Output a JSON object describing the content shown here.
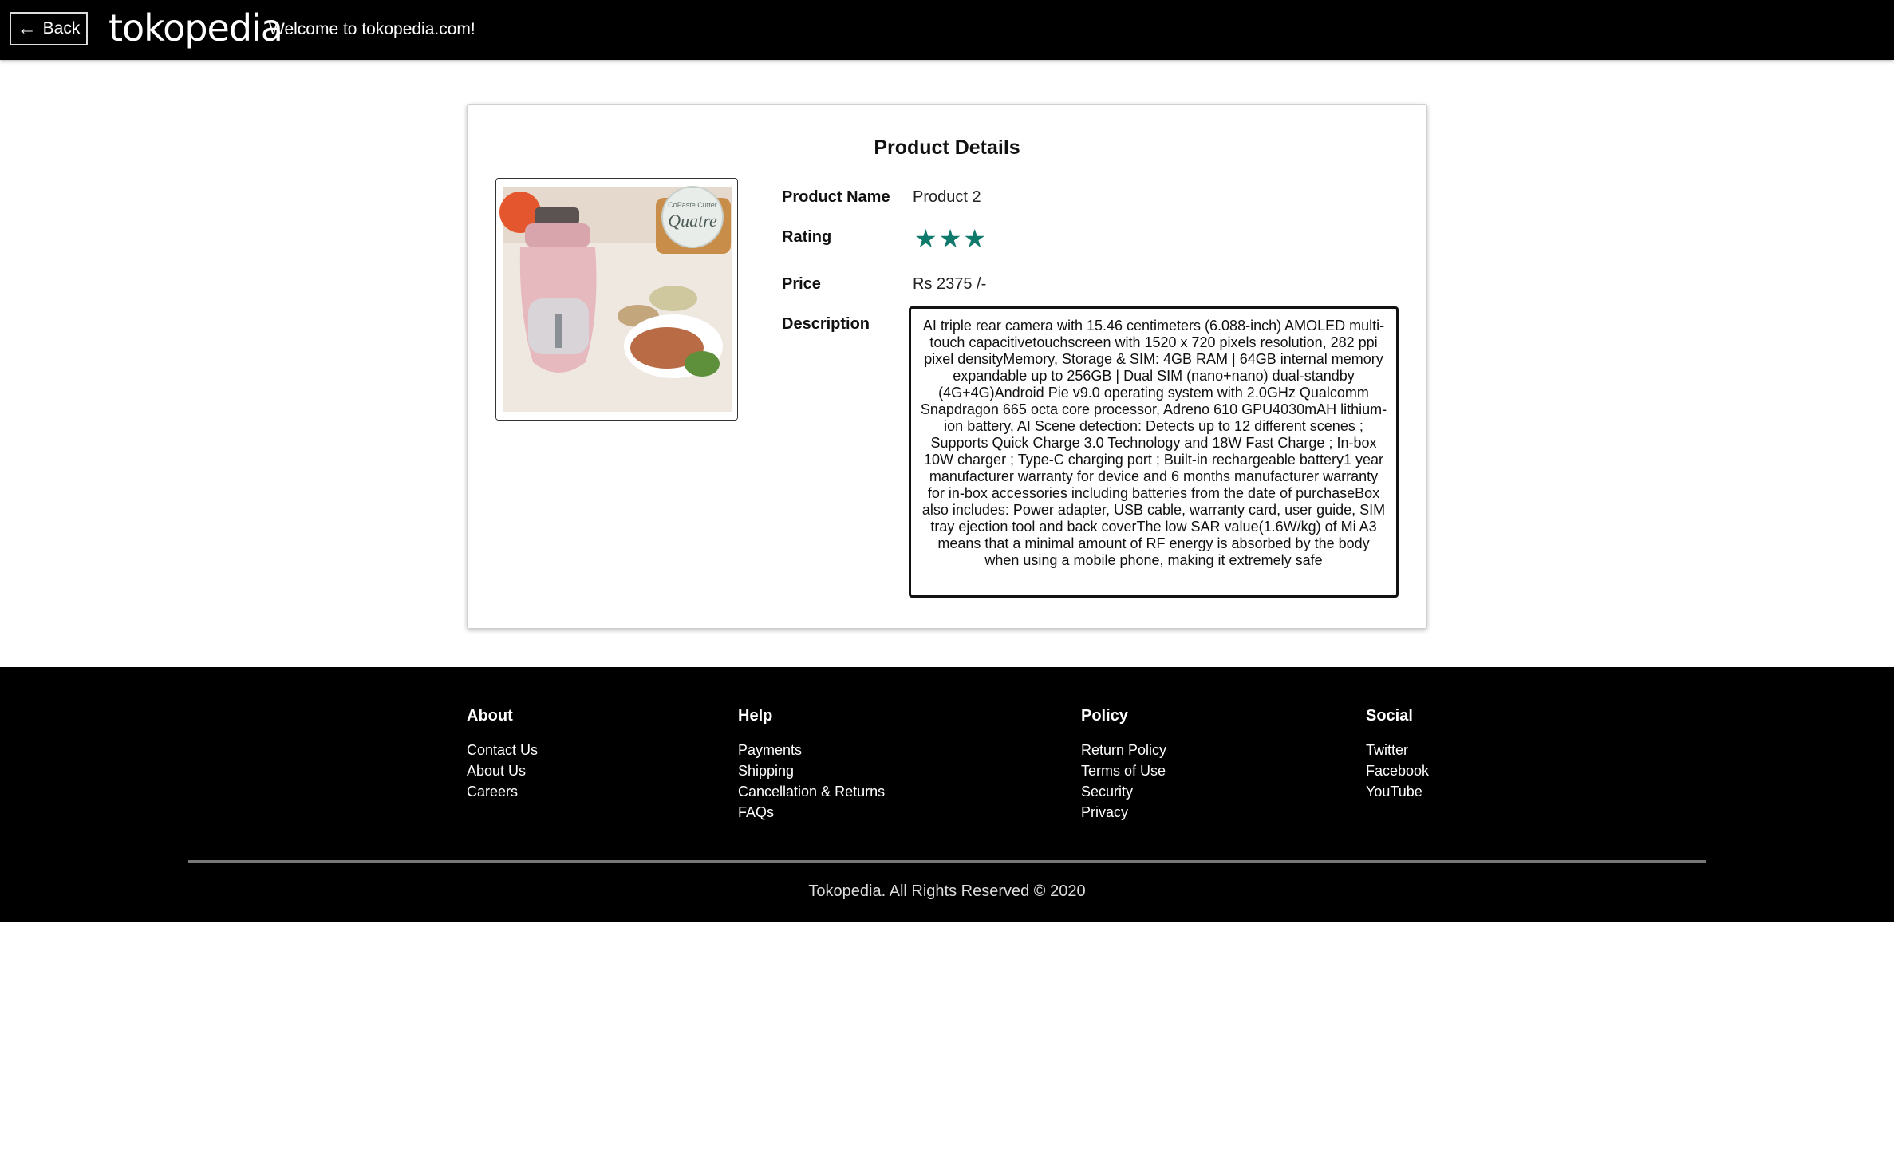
{
  "header": {
    "back_label": "Back",
    "logo": "tokopedia",
    "welcome": "Welcome to tokopedia.com!"
  },
  "product": {
    "title": "Product Details",
    "image_brand_text": "Quatre",
    "image_brand_small": "CoPaste Cutter",
    "labels": {
      "name": "Product Name",
      "rating": "Rating",
      "price": "Price",
      "description": "Description"
    },
    "name": "Product 2",
    "rating": 3,
    "price": "Rs 2375 /-",
    "description": "AI triple rear camera with 15.46 centimeters (6.088-inch) AMOLED multi-touch capacitivetouchscreen with 1520 x 720 pixels resolution, 282 ppi pixel densityMemory, Storage & SIM: 4GB RAM | 64GB internal memory expandable up to 256GB | Dual SIM (nano+nano) dual-standby (4G+4G)Android Pie v9.0 operating system with 2.0GHz Qualcomm Snapdragon 665 octa core processor, Adreno 610 GPU4030mAH lithium-ion battery, AI Scene detection: Detects up to 12 different scenes ; Supports Quick Charge 3.0 Technology and 18W Fast Charge ; In-box 10W charger ; Type-C charging port ; Built-in rechargeable battery1 year manufacturer warranty for device and 6 months manufacturer warranty for in-box accessories including batteries from the date of purchaseBox also includes: Power adapter, USB cable, warranty card, user guide, SIM tray ejection tool and back coverThe low SAR value(1.6W/kg) of Mi A3 means that a minimal amount of RF energy is absorbed by the body when using a mobile phone, making it extremely safe",
    "star_color": "#0f7a6c"
  },
  "footer": {
    "columns": [
      {
        "title": "About",
        "links": [
          "Contact Us",
          "About Us",
          "Careers"
        ]
      },
      {
        "title": "Help",
        "links": [
          "Payments",
          "Shipping",
          "Cancellation & Returns",
          "FAQs"
        ]
      },
      {
        "title": "Policy",
        "links": [
          "Return Policy",
          "Terms of Use",
          "Security",
          "Privacy"
        ]
      },
      {
        "title": "Social",
        "links": [
          "Twitter",
          "Facebook",
          "YouTube"
        ]
      }
    ],
    "copyright": "Tokopedia. All Rights Reserved © 2020"
  }
}
